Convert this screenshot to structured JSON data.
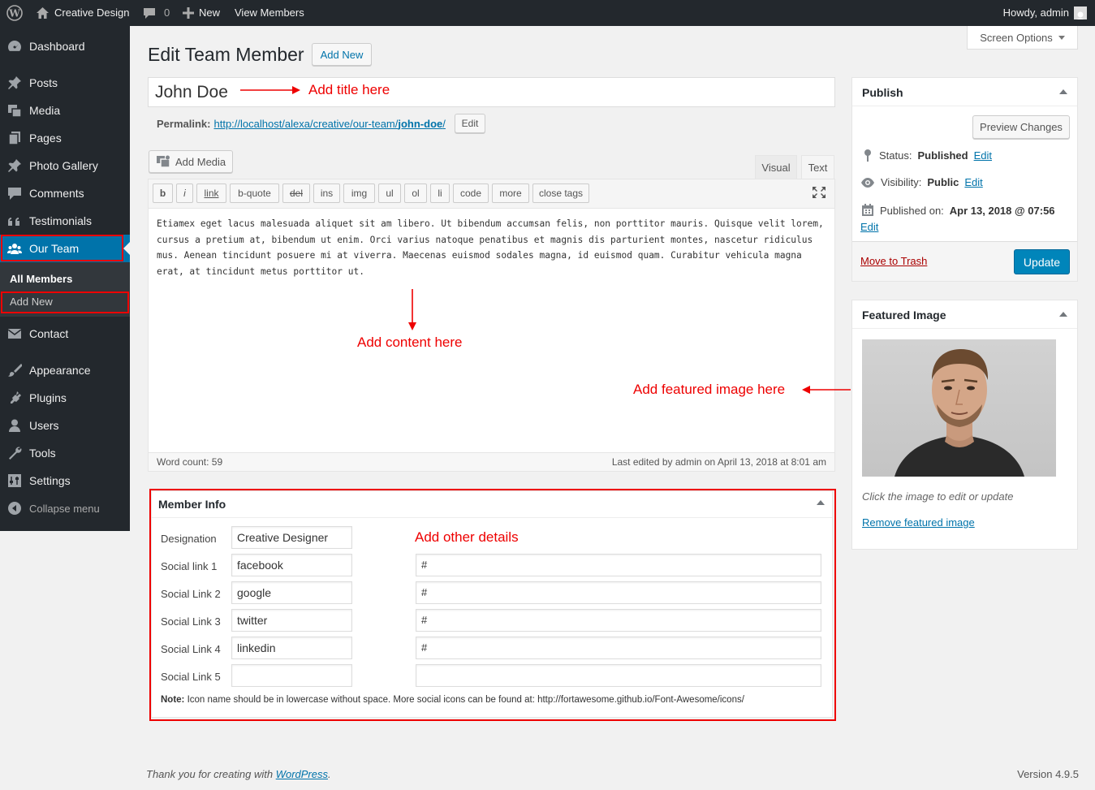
{
  "adminbar": {
    "site_name": "Creative Design",
    "comments_count": "0",
    "new_label": "New",
    "view_label": "View Members",
    "howdy": "Howdy, admin"
  },
  "sidebar": {
    "items": [
      {
        "label": "Dashboard",
        "icon": "dashboard-icon"
      },
      {
        "label": "Posts",
        "icon": "pin-icon"
      },
      {
        "label": "Media",
        "icon": "media-icon"
      },
      {
        "label": "Pages",
        "icon": "pages-icon"
      },
      {
        "label": "Photo Gallery",
        "icon": "pin-icon"
      },
      {
        "label": "Comments",
        "icon": "comment-icon"
      },
      {
        "label": "Testimonials",
        "icon": "quote-icon"
      },
      {
        "label": "Our Team",
        "icon": "team-icon"
      },
      {
        "label": "Contact",
        "icon": "mail-icon"
      },
      {
        "label": "Appearance",
        "icon": "brush-icon"
      },
      {
        "label": "Plugins",
        "icon": "plugin-icon"
      },
      {
        "label": "Users",
        "icon": "user-icon"
      },
      {
        "label": "Tools",
        "icon": "wrench-icon"
      },
      {
        "label": "Settings",
        "icon": "settings-icon"
      },
      {
        "label": "Collapse menu",
        "icon": "collapse-icon"
      }
    ],
    "submenu": {
      "all": "All Members",
      "add": "Add New"
    }
  },
  "screen_options": "Screen Options",
  "page": {
    "title": "Edit Team Member",
    "add_new": "Add New"
  },
  "post": {
    "title": "John Doe",
    "permalink_label": "Permalink:",
    "permalink_url": "http://localhost/alexa/creative/our-team/",
    "permalink_slug": "john-doe",
    "permalink_end": "/",
    "edit": "Edit"
  },
  "editor": {
    "add_media": "Add Media",
    "tab_visual": "Visual",
    "tab_text": "Text",
    "quicktags": [
      "b",
      "i",
      "link",
      "b-quote",
      "del",
      "ins",
      "img",
      "ul",
      "ol",
      "li",
      "code",
      "more",
      "close tags"
    ],
    "content": "Etiamex eget lacus malesuada aliquet sit am libero. Ut bibendum accumsan felis, non porttitor mauris. Quisque velit lorem, cursus a pretium at, bibendum ut enim. Orci varius natoque penatibus et magnis dis parturient montes, nascetur ridiculus mus. Aenean tincidunt posuere mi at viverra. Maecenas euismod sodales magna, id euismod quam. Curabitur vehicula magna erat, at tincidunt metus porttitor ut.",
    "word_count": "Word count: 59",
    "last_edited": "Last edited by admin on April 13, 2018 at 8:01 am"
  },
  "annotations": {
    "title": "Add title here",
    "content": "Add content here",
    "featured": "Add featured image here",
    "details": "Add other details"
  },
  "member_info": {
    "heading": "Member Info",
    "rows": [
      {
        "label": "Designation",
        "value": "Creative Designer",
        "link": null
      },
      {
        "label": "Social link 1",
        "value": "facebook",
        "link": "#"
      },
      {
        "label": "Social Link 2",
        "value": "google",
        "link": "#"
      },
      {
        "label": "Social Link 3",
        "value": "twitter",
        "link": "#"
      },
      {
        "label": "Social Link 4",
        "value": "linkedin",
        "link": "#"
      },
      {
        "label": "Social Link 5",
        "value": "",
        "link": ""
      }
    ],
    "note_label": "Note:",
    "note": "Icon name should be in lowercase without space. More social icons can be found at: http://fortawesome.github.io/Font-Awesome/icons/"
  },
  "publish": {
    "heading": "Publish",
    "preview": "Preview Changes",
    "status_label": "Status:",
    "status_value": "Published",
    "visibility_label": "Visibility:",
    "visibility_value": "Public",
    "published_label": "Published on:",
    "published_value": "Apr 13, 2018 @ 07:56",
    "edit": "Edit",
    "trash": "Move to Trash",
    "update": "Update"
  },
  "featured": {
    "heading": "Featured Image",
    "hint": "Click the image to edit or update",
    "remove": "Remove featured image"
  },
  "footer": {
    "thanks": "Thank you for creating with ",
    "wp": "WordPress",
    "dot": ".",
    "version": "Version 4.9.5"
  },
  "colors": {
    "accent": "#0073aa",
    "annotation": "#e00000",
    "adminbar": "#23282d"
  }
}
